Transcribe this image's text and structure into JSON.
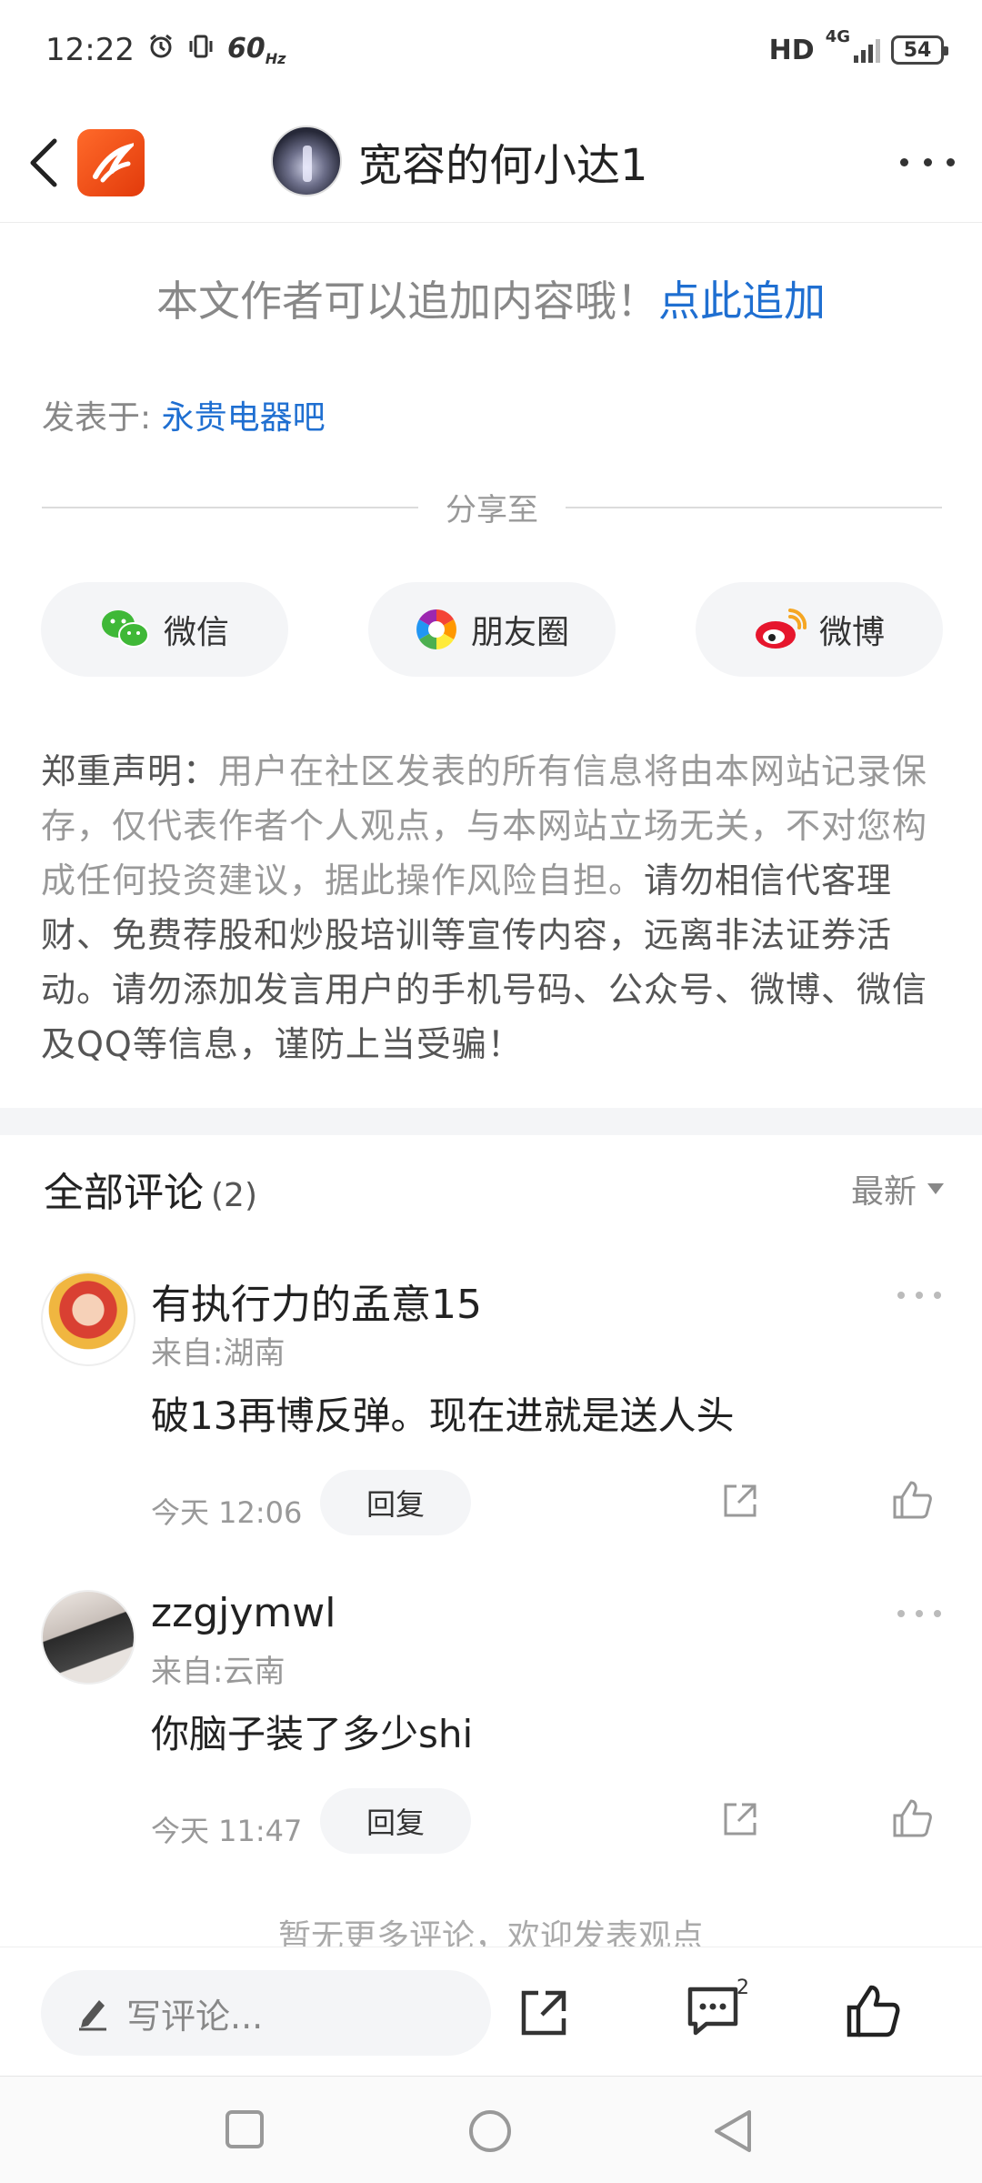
{
  "status_bar": {
    "time": "12:22",
    "refresh_rate": "60",
    "refresh_unit": "Hz",
    "hd": "HD",
    "network": "4G",
    "battery": "54"
  },
  "header": {
    "title": "宽容的何小达1"
  },
  "append_notice": {
    "text": "本文作者可以追加内容哦！",
    "link": "点此追加"
  },
  "posted_in": {
    "label": "发表于: ",
    "forum": "永贵电器吧"
  },
  "share": {
    "label": "分享至",
    "buttons": [
      {
        "label": "微信",
        "icon": "wechat-icon"
      },
      {
        "label": "朋友圈",
        "icon": "moments-icon"
      },
      {
        "label": "微博",
        "icon": "weibo-icon"
      }
    ]
  },
  "disclaimer": {
    "title": "郑重声明：",
    "part1": "用户在社区发表的所有信息将由本网站记录保存，仅代表作者个人观点，与本网站立场无关，不对您构成任何投资建议，据此操作风险自担。",
    "part2": "请勿相信代客理财、免费荐股和炒股培训等宣传内容，远离非法证券活动。请勿添加发言用户的手机号码、公众号、微博、微信及QQ等信息，谨防上当受骗！"
  },
  "comments": {
    "title": "全部评论",
    "count": "(2)",
    "sort": "最新",
    "items": [
      {
        "name": "有执行力的孟意15",
        "location": "来自:湖南",
        "text": "破13再博反弹。现在进就是送人头",
        "time": "今天 12:06",
        "reply": "回复"
      },
      {
        "name": "zzgjymwl",
        "location": "来自:云南",
        "text": "你脑子装了多少shi",
        "time": "今天 11:47",
        "reply": "回复"
      }
    ],
    "no_more": "暂无更多评论，欢迎发表观点"
  },
  "bottom_bar": {
    "input_placeholder": "写评论...",
    "comment_badge": "2"
  },
  "colors": {
    "link": "#1f6fd1",
    "brand": "#ff6a2a"
  }
}
